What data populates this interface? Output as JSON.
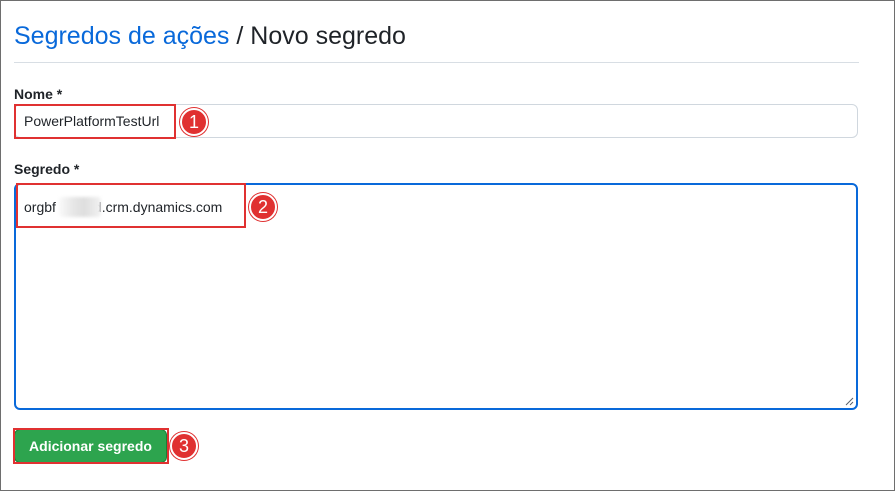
{
  "breadcrumb": {
    "parent": "Segredos de ações",
    "separator": " / ",
    "current": "Novo segredo"
  },
  "form": {
    "name_label": "Nome *",
    "name_value": "PowerPlatformTestUrl",
    "secret_label": "Segredo *",
    "secret_value_prefix": "orgbf",
    "secret_value_suffix": "d.crm.dynamics.com",
    "submit_label": "Adicionar segredo"
  },
  "annotations": {
    "step1": "1",
    "step2": "2",
    "step3": "3"
  },
  "colors": {
    "link": "#0969da",
    "focus_border": "#0969da",
    "button_bg": "#2da44e",
    "annotation_red": "#e03131"
  }
}
